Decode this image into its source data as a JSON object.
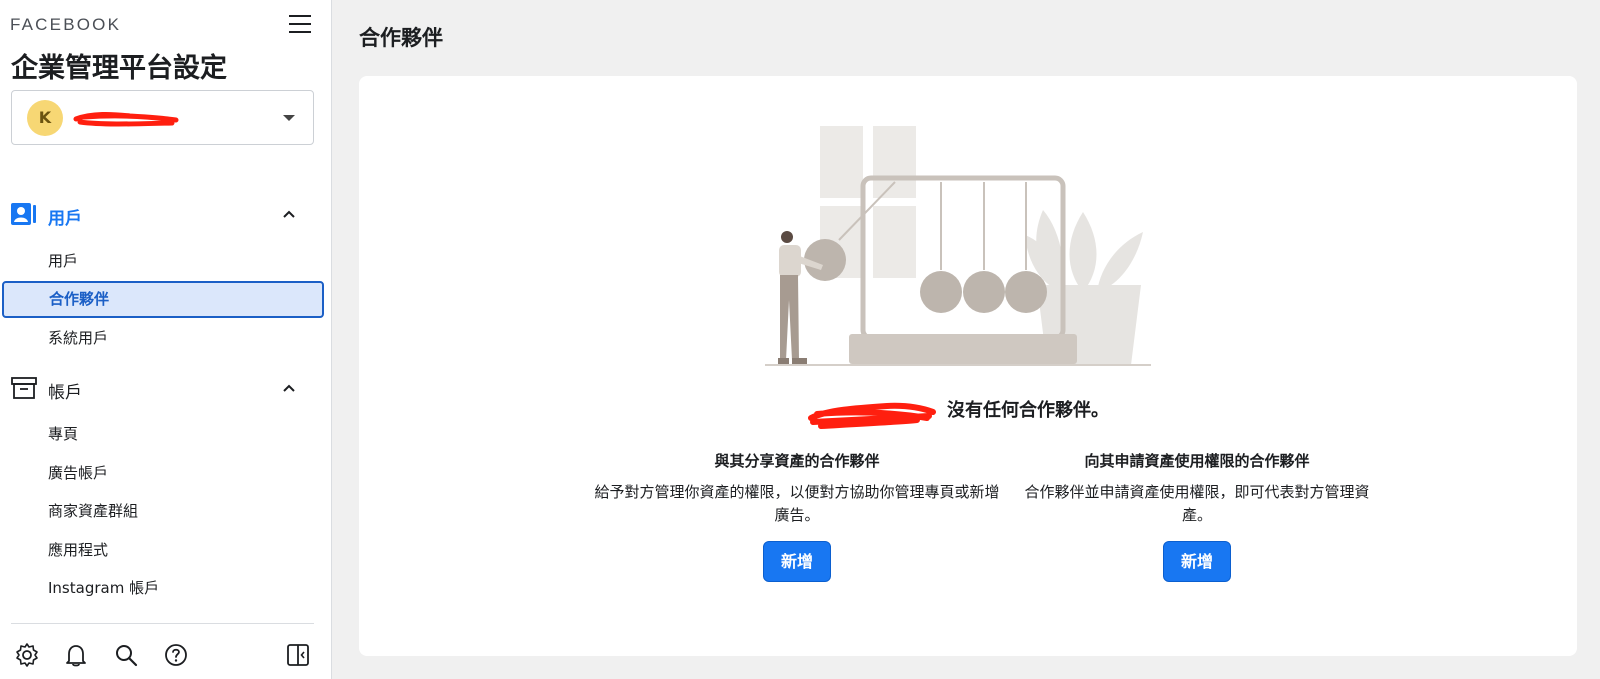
{
  "sidebar": {
    "brand": "FACEBOOK",
    "title": "企業管理平台設定",
    "account": {
      "avatar_letter": "K",
      "name_redacted": true
    },
    "sections": [
      {
        "label": "用戶",
        "expanded": true,
        "items": [
          "用戶",
          "合作夥伴",
          "系統用戶"
        ],
        "selected": "合作夥伴"
      },
      {
        "label": "帳戶",
        "expanded": true,
        "items": [
          "專頁",
          "廣告帳戶",
          "商家資產群組",
          "應用程式",
          "Instagram 帳戶"
        ]
      }
    ],
    "footer_icons": [
      "gear-icon",
      "bell-icon",
      "search-icon",
      "help-icon",
      "panel-toggle-icon"
    ]
  },
  "main": {
    "page_title": "合作夥伴",
    "empty_message": "沒有任何合作夥伴。",
    "columns": [
      {
        "heading": "與其分享資產的合作夥伴",
        "desc_line1": "給予對方管理你資產的權限，以便對方協助你管理專頁或新增",
        "desc_line2": "廣告。",
        "button": "新增"
      },
      {
        "heading": "向其申請資產使用權限的合作夥伴",
        "desc_line1": "合作夥伴並申請資產使用權限，即可代表對方管理資",
        "desc_line2": "產。",
        "button": "新增"
      }
    ]
  },
  "colors": {
    "accent": "#1877f2",
    "selected_bg": "#dbe7fb",
    "selected_border": "#1b5fc6",
    "avatar": "#f7d774",
    "redaction": "#ff1f0f"
  }
}
